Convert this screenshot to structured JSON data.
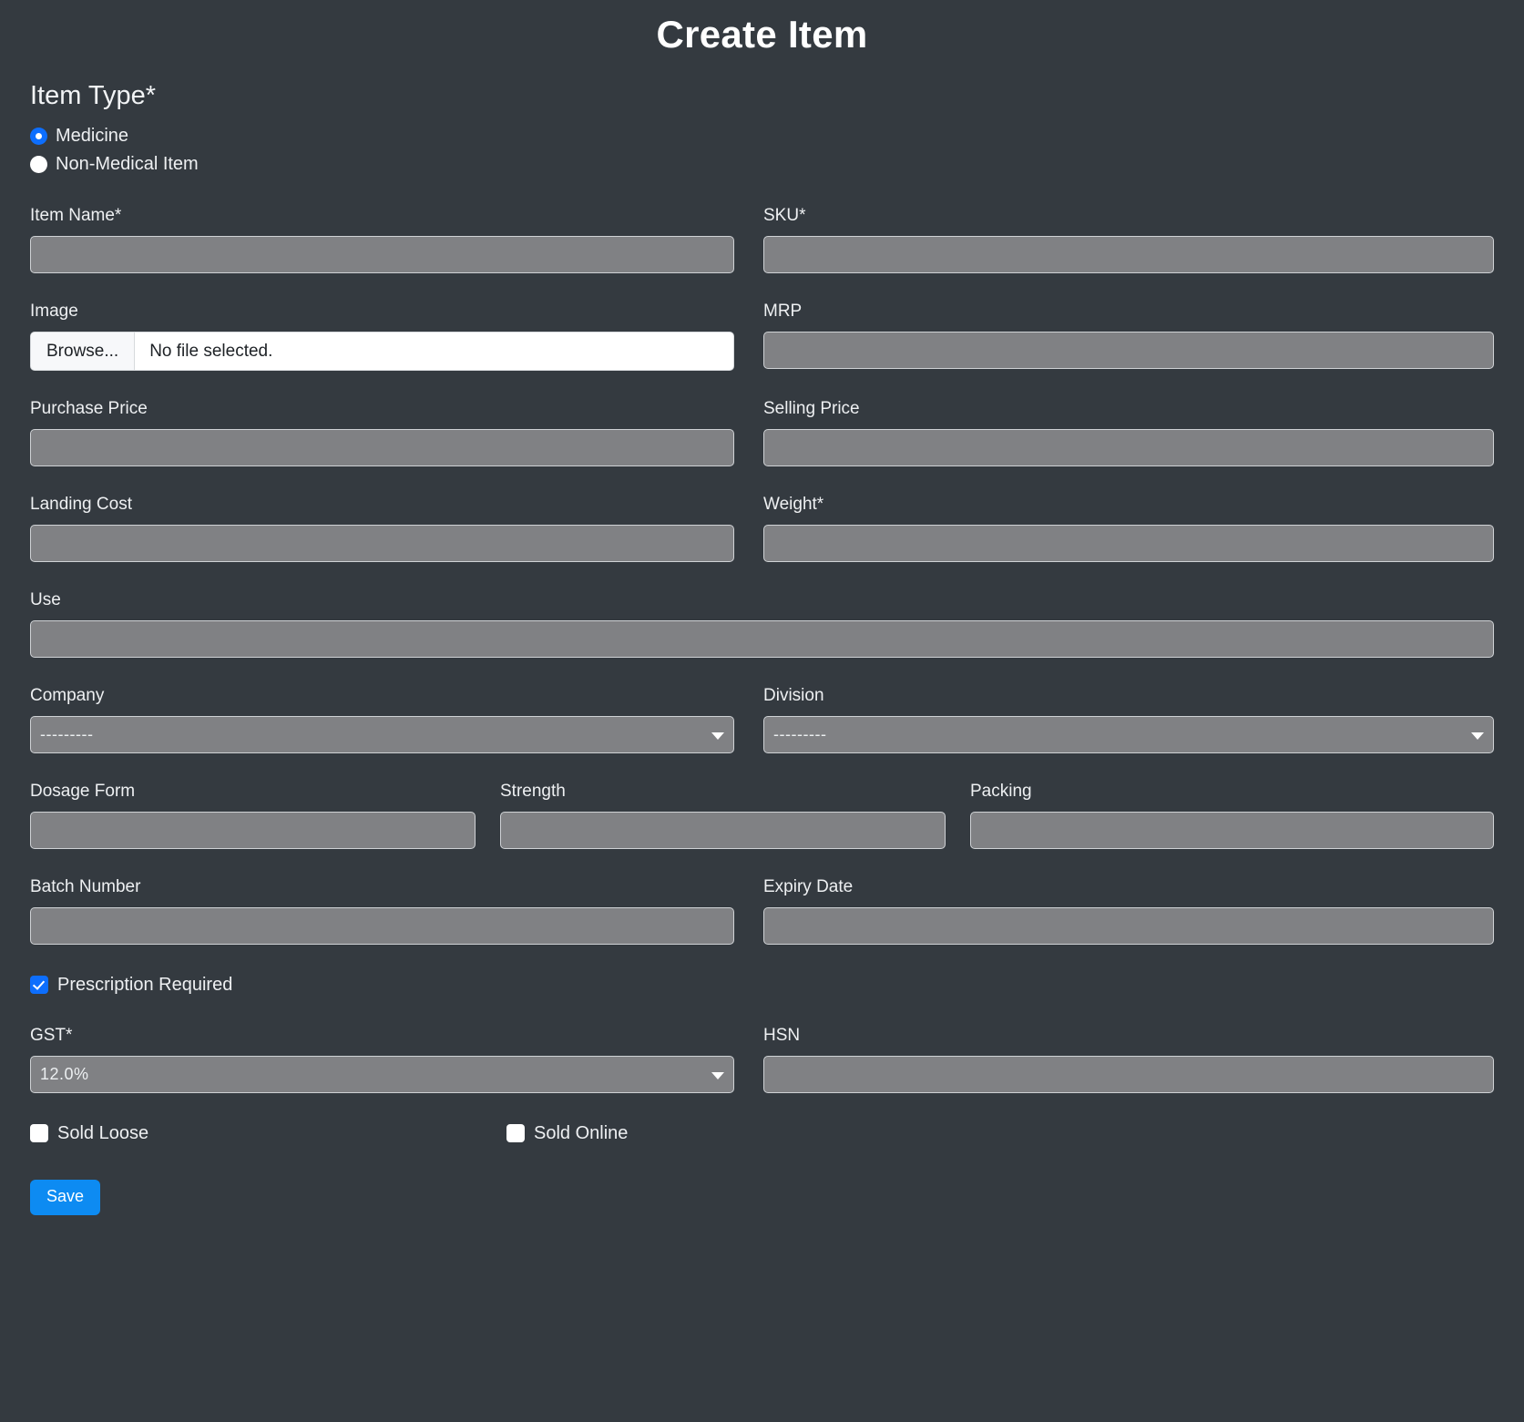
{
  "page": {
    "title": "Create Item",
    "background_color": "#343a40",
    "accent_color": "#0d6efd",
    "save_button_color": "#0d8bf2",
    "input_background": "#808184"
  },
  "item_type": {
    "heading": "Item Type*",
    "options": [
      {
        "label": "Medicine",
        "checked": true
      },
      {
        "label": "Non-Medical Item",
        "checked": false
      }
    ]
  },
  "fields": {
    "item_name": {
      "label": "Item Name*",
      "value": "",
      "placeholder": ""
    },
    "sku": {
      "label": "SKU*",
      "value": "",
      "placeholder": ""
    },
    "image": {
      "label": "Image",
      "browse_label": "Browse...",
      "file_status": "No file selected."
    },
    "mrp": {
      "label": "MRP",
      "value": "",
      "placeholder": ""
    },
    "purchase_price": {
      "label": "Purchase Price",
      "value": "",
      "placeholder": ""
    },
    "selling_price": {
      "label": "Selling Price",
      "value": "",
      "placeholder": ""
    },
    "landing_cost": {
      "label": "Landing Cost",
      "value": "",
      "placeholder": ""
    },
    "weight": {
      "label": "Weight*",
      "value": "",
      "placeholder": ""
    },
    "use": {
      "label": "Use",
      "value": "",
      "placeholder": ""
    },
    "company": {
      "label": "Company",
      "selected": "---------"
    },
    "division": {
      "label": "Division",
      "selected": "---------"
    },
    "dosage_form": {
      "label": "Dosage Form",
      "value": "",
      "placeholder": ""
    },
    "strength": {
      "label": "Strength",
      "value": "",
      "placeholder": ""
    },
    "packing": {
      "label": "Packing",
      "value": "",
      "placeholder": ""
    },
    "batch_number": {
      "label": "Batch Number",
      "value": "",
      "placeholder": ""
    },
    "expiry_date": {
      "label": "Expiry Date",
      "value": "",
      "placeholder": ""
    },
    "gst": {
      "label": "GST*",
      "selected": "12.0%"
    },
    "hsn": {
      "label": "HSN",
      "value": "",
      "placeholder": ""
    }
  },
  "checkboxes": {
    "prescription_required": {
      "label": "Prescription Required",
      "checked": true
    },
    "sold_loose": {
      "label": "Sold Loose",
      "checked": false
    },
    "sold_online": {
      "label": "Sold Online",
      "checked": false
    }
  },
  "actions": {
    "save_label": "Save"
  }
}
